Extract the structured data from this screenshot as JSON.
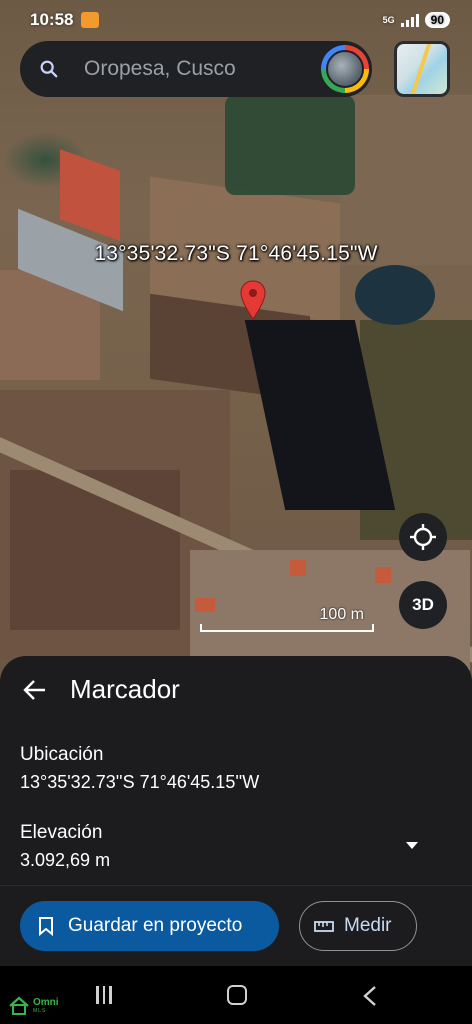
{
  "status_bar": {
    "time": "10:58",
    "network": "5G",
    "battery": "90"
  },
  "search": {
    "placeholder": "Oropesa, Cusco"
  },
  "map": {
    "pin_coordinates": "13°35'32.73\"S 71°46'45.15\"W",
    "scale_label": "100 m",
    "three_d_label": "3D",
    "pin_color": "#e53935"
  },
  "sheet": {
    "title": "Marcador",
    "location_label": "Ubicación",
    "location_value": "13°35'32.73''S 71°46'45.15''W",
    "elevation_label": "Elevación",
    "elevation_value": "3.092,69 m",
    "save_button": "Guardar en proyecto",
    "measure_button": "Medir",
    "accent_color": "#0b5aa0"
  },
  "watermark": {
    "text": "Omni",
    "subtext": "MLS"
  }
}
